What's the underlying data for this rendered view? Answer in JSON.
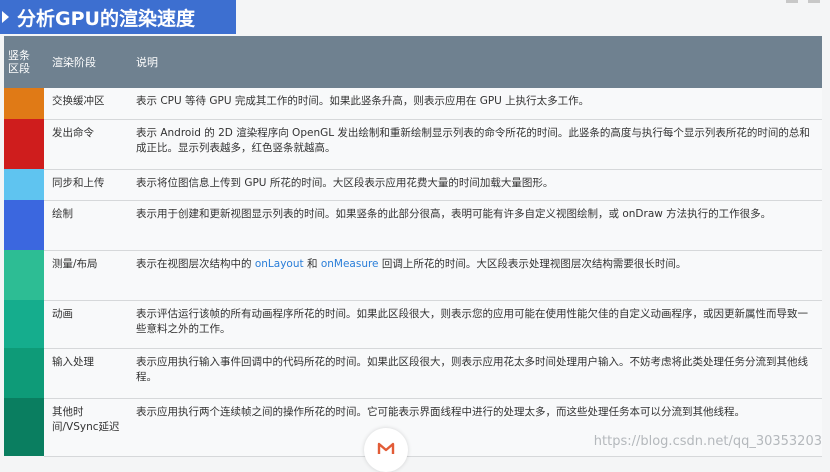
{
  "page": {
    "title": "分析GPU的渲染速度",
    "watermark": "https://blog.csdn.net/qq_30353203"
  },
  "table": {
    "headers": {
      "color": "竖条区段",
      "stage": "渲染阶段",
      "desc": "说明"
    },
    "rows": [
      {
        "color": "#e07a16",
        "stage": "交换缓冲区",
        "desc": [
          "表示 CPU 等待 GPU 完成其工作的时间。如果此竖条升高，则表示应用在 GPU 上执行太多工作。"
        ]
      },
      {
        "color": "#cf1d1d",
        "stage": "发出命令",
        "desc": [
          "表示 Android 的 2D 渲染程序向 OpenGL 发出绘制和重新绘制显示列表的命令所花的时间。此竖条的高度与执行每个显示列表所花的时间的总和成正比。显示列表越多，红色竖条就越高。"
        ]
      },
      {
        "color": "#5fc4f0",
        "stage": "同步和上传",
        "desc": [
          "表示将位图信息上传到 GPU 所花的时间。大区段表示应用花费大量的时间加载大量图形。"
        ]
      },
      {
        "color": "#3b67df",
        "stage": "绘制",
        "desc": [
          "表示用于创建和更新视图显示列表的时间。如果竖条的此部分很高，表明可能有许多自定义视图绘制，或 onDraw 方法执行的工作很多。"
        ]
      },
      {
        "color": "#2dbd94",
        "stage": "测量/布局",
        "desc": [
          "表示在视图层次结构中的 ",
          "onLayout",
          " 和 ",
          "onMeasure",
          " 回调上所花的时间。大区段表示处理视图层次结构需要很长时间。"
        ]
      },
      {
        "color": "#15ad8d",
        "stage": "动画",
        "desc": [
          "表示评估运行该帧的所有动画程序所花的时间。如果此区段很大，则表示您的应用可能在使用性能欠佳的自定义动画程序，或因更新属性而导致一些意料之外的工作。"
        ]
      },
      {
        "color": "#0e9b78",
        "stage": "输入处理",
        "desc": [
          "表示应用执行输入事件回调中的代码所花的时间。如果此区段很大，则表示应用花太多时间处理用户输入。不妨考虑将此类处理任务分流到其他线程。"
        ]
      },
      {
        "color": "#0a7e60",
        "stage": "其他时间/VSync延迟",
        "desc": [
          "表示应用执行两个连续帧之间的操作所花的时间。它可能表示界面线程中进行的处理太多，而这些处理任务本可以分流到其他线程。"
        ]
      }
    ]
  },
  "colors": {
    "banner": "#3d6fd0",
    "header": "#6f8190",
    "link": "#2a7ed8"
  },
  "icons": {
    "banner": "arrow-right-icon",
    "logo": "csdn-logo-icon"
  }
}
